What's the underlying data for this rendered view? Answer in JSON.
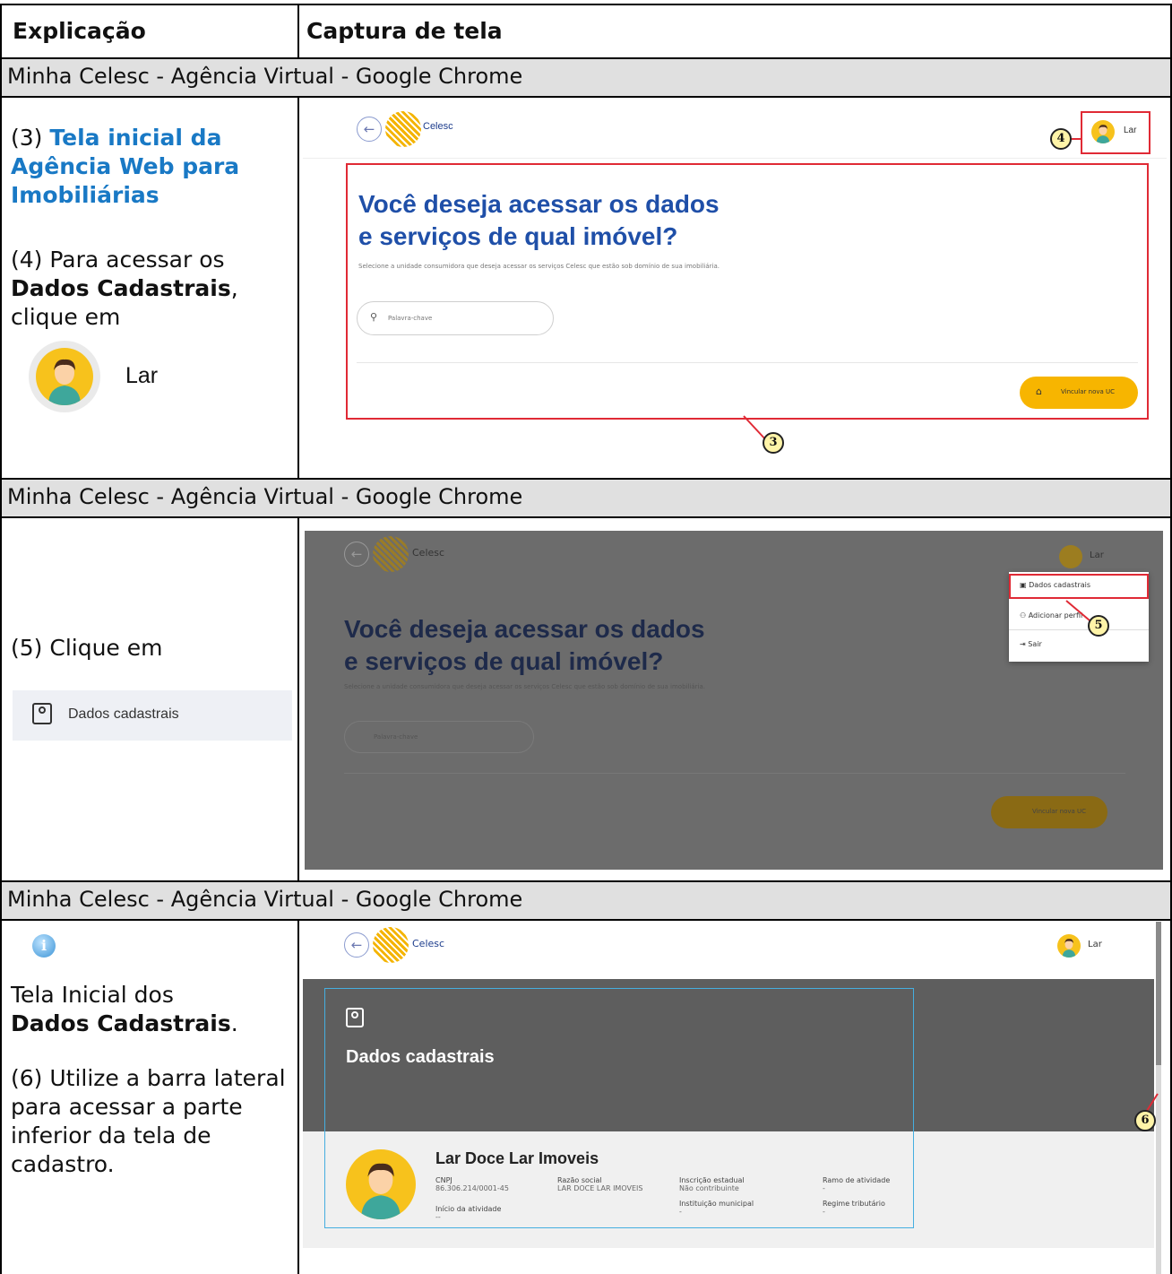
{
  "headers": {
    "left": "Explicação",
    "right": "Captura de tela"
  },
  "window_title": "Minha Celesc - Agência Virtual - Google Chrome",
  "section1": {
    "step3_num": "(3)",
    "step3_title": "Tela inicial da Agência Web para Imobiliárias",
    "step4_text": "(4) Para acessar os",
    "step4_bold": "Dados Cadastrais",
    "step4_comma": ",",
    "step4_tail": "clique em",
    "user_label": "Lar",
    "shot": {
      "logo": "Celesc",
      "user": "Lar",
      "heading1": "Você deseja acessar os dados",
      "heading2": "e serviços de qual imóvel?",
      "subtitle": "Selecione a unidade consumidora que deseja acessar os serviços Celesc que estão sob domínio de sua imobiliária.",
      "search_placeholder": "Palavra-chave",
      "button": "Vincular nova UC",
      "callout_3": "3",
      "callout_4": "4"
    }
  },
  "section2": {
    "step5_text": "(5) Clique em",
    "menu_example": "Dados cadastrais",
    "shot": {
      "logo": "Celesc",
      "user": "Lar",
      "heading1": "Você deseja acessar os dados",
      "heading2": "e serviços de qual imóvel?",
      "subtitle": "Selecione a unidade consumidora que deseja acessar os serviços Celesc que estão sob domínio de sua imobiliária.",
      "search_placeholder": "Palavra-chave",
      "button": "Vincular nova UC",
      "menu": [
        "Dados cadastrais",
        "Adicionar perfil",
        "Sair"
      ],
      "callout_5": "5"
    }
  },
  "section3": {
    "line1": "Tela Inicial dos",
    "line2_bold": "Dados Cadastrais",
    "line2_dot": ".",
    "step6": "(6) Utilize a barra lateral para acessar a parte inferior da tela de cadastro.",
    "shot": {
      "logo": "Celesc",
      "user": "Lar",
      "banner_title": "Dados cadastrais",
      "company": "Lar Doce Lar Imoveis",
      "fields": [
        {
          "label": "CNPJ",
          "value": "86.306.214/0001-45"
        },
        {
          "label": "Razão social",
          "value": "LAR DOCE LAR IMOVEIS"
        },
        {
          "label": "Inscrição estadual",
          "value": "Não contribuinte"
        },
        {
          "label": "Ramo de atividade",
          "value": "-"
        },
        {
          "label": "Início da atividade",
          "value": "--"
        },
        {
          "label": "Instituição municipal",
          "value": "-"
        },
        {
          "label": "Regime tributário",
          "value": "-"
        }
      ],
      "callout_6": "6"
    }
  },
  "colors": {
    "title_blue": "#1979c5",
    "heading_blue": "#1f4fa8",
    "accent_yellow": "#f7b500",
    "highlight_red": "#e02a35",
    "grey_bar": "#e0e0e0"
  }
}
